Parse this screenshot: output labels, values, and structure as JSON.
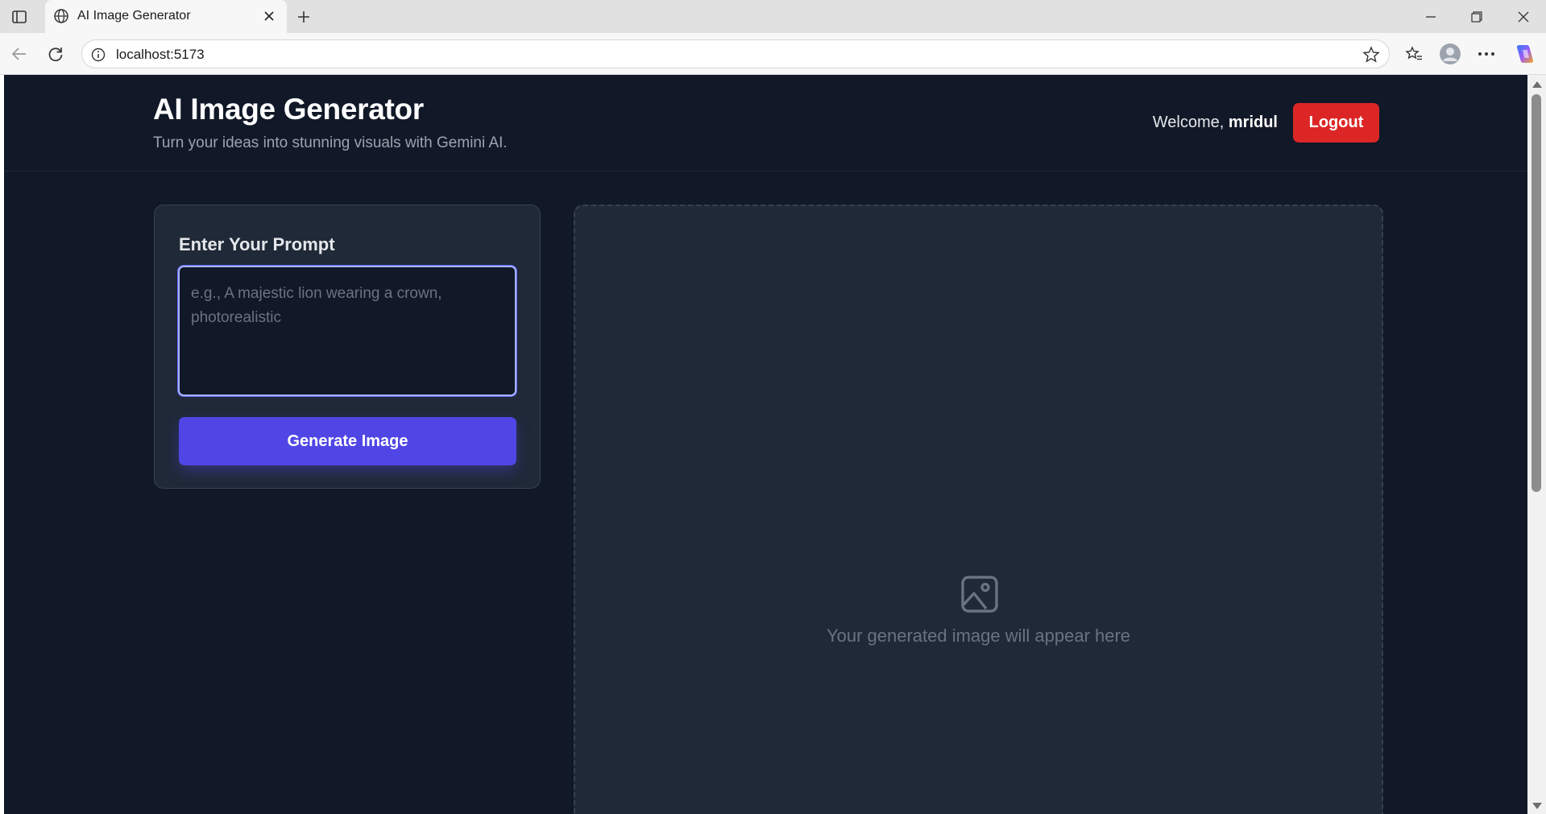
{
  "browser": {
    "tab_title": "AI Image Generator",
    "url": "localhost:5173"
  },
  "header": {
    "title": "AI Image Generator",
    "subtitle": "Turn your ideas into stunning visuals with Gemini AI.",
    "welcome_prefix": "Welcome,",
    "username": "mridul",
    "logout_label": "Logout"
  },
  "prompt": {
    "heading": "Enter Your Prompt",
    "value": "",
    "placeholder": "e.g., A majestic lion wearing a crown, photorealistic",
    "generate_label": "Generate Image"
  },
  "output": {
    "empty_message": "Your generated image will appear here",
    "icon": "image-icon"
  },
  "colors": {
    "page_bg": "#111827",
    "card_bg": "#1f2937",
    "primary": "#4f46e5",
    "danger": "#dc2626",
    "focus_ring": "#a5b4fc"
  }
}
